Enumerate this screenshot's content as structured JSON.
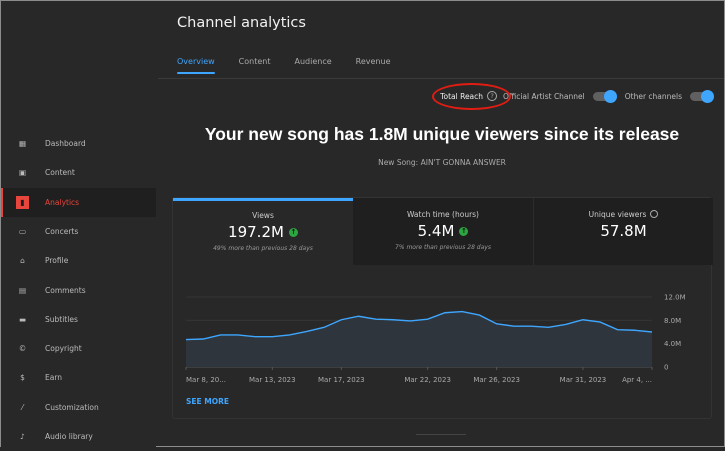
{
  "sidebar": {
    "items": [
      {
        "label": "Dashboard",
        "icon": "dashboard-icon"
      },
      {
        "label": "Content",
        "icon": "content-icon"
      },
      {
        "label": "Analytics",
        "icon": "analytics-icon",
        "active": true
      },
      {
        "label": "Concerts",
        "icon": "ticket-icon"
      },
      {
        "label": "Profile",
        "icon": "person-icon"
      },
      {
        "label": "Comments",
        "icon": "comment-icon"
      },
      {
        "label": "Subtitles",
        "icon": "subtitles-icon"
      },
      {
        "label": "Copyright",
        "icon": "copyright-icon"
      },
      {
        "label": "Earn",
        "icon": "dollar-icon"
      },
      {
        "label": "Customization",
        "icon": "magic-wand-icon"
      },
      {
        "label": "Audio library",
        "icon": "audio-library-icon"
      }
    ]
  },
  "header": {
    "title": "Channel analytics",
    "tabs": [
      "Overview",
      "Content",
      "Audience",
      "Revenue"
    ],
    "active_tab": "Overview"
  },
  "filters": {
    "total_reach": "Total Reach",
    "help": "?",
    "official_artist_channel": "Official Artist Channel",
    "official_on": true,
    "other_channels": "Other channels",
    "other_on": true
  },
  "headline": "Your new song has 1.8M unique viewers since its release",
  "subline": "New Song: AIN'T GONNA ANSWER",
  "metrics": [
    {
      "label": "Views",
      "value": "197.2M",
      "trend": "up",
      "note": "49% more than previous 28 days"
    },
    {
      "label": "Watch time (hours)",
      "value": "5.4M",
      "trend": "up",
      "note": "7% more than previous 28 days"
    },
    {
      "label": "Unique viewers",
      "value": "57.8M",
      "icon": "clock-icon"
    }
  ],
  "see_more": "SEE MORE",
  "colors": {
    "accent": "#3ea6ff",
    "active_nav": "#e8453c",
    "up": "#2ba640",
    "annotation": "#e11d13"
  },
  "chart_data": {
    "type": "area",
    "x_tick_labels": [
      "Mar 8, 20...",
      "Mar 13, 2023",
      "Mar 17, 2023",
      "Mar 22, 2023",
      "Mar 26, 2023",
      "Mar 31, 2023",
      "Apr 4, ..."
    ],
    "x_tick_index": [
      0,
      5,
      9,
      14,
      18,
      23,
      27
    ],
    "y_tick_labels": [
      "0",
      "4.0M",
      "8.0M",
      "12.0M"
    ],
    "ylim": [
      0,
      12000000
    ],
    "grid": true,
    "values": [
      4.7,
      4.8,
      5.5,
      5.5,
      5.2,
      5.2,
      5.5,
      6.1,
      6.8,
      8.1,
      8.7,
      8.2,
      8.1,
      7.9,
      8.2,
      9.3,
      9.5,
      8.9,
      7.4,
      7.0,
      7.0,
      6.8,
      7.3,
      8.1,
      7.7,
      6.4,
      6.3,
      6.0
    ],
    "value_unit": "M",
    "line_color": "#3ea6ff"
  }
}
